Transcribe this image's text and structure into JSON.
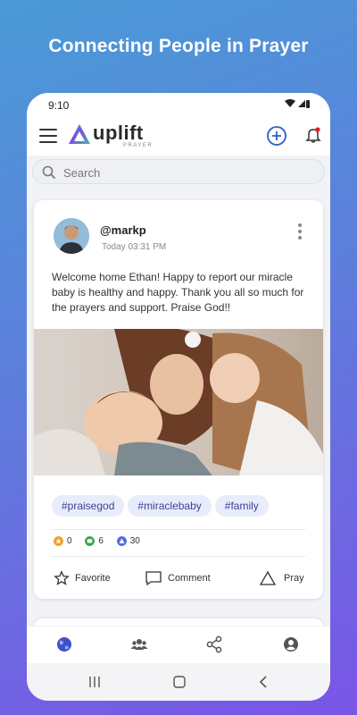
{
  "headline": "Connecting People in Prayer",
  "status_bar": {
    "time": "9:10"
  },
  "app": {
    "logo_word": "uplift",
    "logo_sub": "PRAYER",
    "brand_color": "#5b4fe0"
  },
  "search": {
    "placeholder": "Search"
  },
  "post": {
    "username": "@markp",
    "timestamp": "Today 03:31 PM",
    "text": "Welcome home Ethan! Happy to report our miracle baby is healthy and happy. Thank you all so much for the prayers and support. Praise God!!",
    "tags": [
      "#praisegod",
      "#miraclebaby",
      "#family"
    ],
    "stats": [
      {
        "icon": "star-icon",
        "value": "0",
        "color": "#f0a020"
      },
      {
        "icon": "comment-icon",
        "value": "6",
        "color": "#3aa24a"
      },
      {
        "icon": "pray-icon",
        "value": "30",
        "color": "#5566e8"
      }
    ],
    "actions": {
      "favorite": "Favorite",
      "comment": "Comment",
      "pray": "Pray"
    }
  },
  "bottom_nav": [
    "globe-icon",
    "community-icon",
    "share-icon",
    "profile-icon"
  ]
}
